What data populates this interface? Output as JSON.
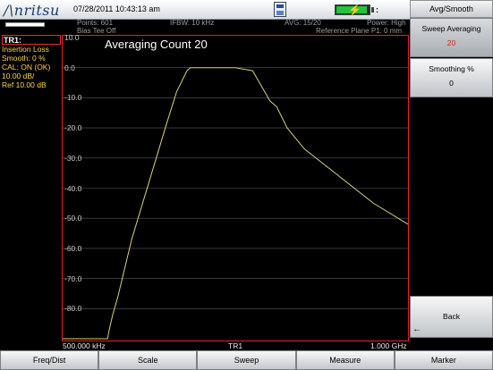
{
  "header": {
    "brand": "/\\nritsu",
    "datetime": "07/28/2011 10:43:13 am",
    "points": "Points: 601",
    "bias_tee": "Bias Tee Off",
    "ifbw": "IFBW: 10 kHz",
    "avg": "AVG: 15/20",
    "power": "Power: High",
    "ref_plane": "Reference Plane P1: 0 mm",
    "battery_level": 0.95,
    "signal": ":"
  },
  "left_panel": {
    "trace": "TR1:",
    "lines": [
      "Insertion Loss",
      "Smooth: 0 %",
      "CAL: ON (OK)",
      "10.00 dB/",
      "Ref 10.00 dB"
    ]
  },
  "graph": {
    "title": "Averaging Count  20",
    "y_ticks": [
      "10.0",
      "0.0",
      "-10.0",
      "-20.0",
      "-30.0",
      "-40.0",
      "-50.0",
      "-60.0",
      "-70.0",
      "-80.0"
    ],
    "x_start": "500.000 kHz",
    "x_center": "TR1",
    "x_stop": "1.000 GHz",
    "ref_arrow": "◀",
    "trace_color": "#d8d27a",
    "grid_color": "#5a5a5a"
  },
  "chart_data": {
    "type": "line",
    "title": "Averaging Count  20",
    "xlabel": "",
    "ylabel": "",
    "x_range": [
      "500.000 kHz",
      "1.000 GHz"
    ],
    "ylim": [
      -90,
      10
    ],
    "y_ticks": [
      10,
      0,
      -10,
      -20,
      -30,
      -40,
      -50,
      -60,
      -70,
      -80
    ],
    "series": [
      {
        "x_fraction": [
          0.0,
          0.13,
          0.135,
          0.145,
          0.16,
          0.2,
          0.25,
          0.3,
          0.33,
          0.36,
          0.37,
          0.4,
          0.5,
          0.55,
          0.57,
          0.6,
          0.62,
          0.65,
          0.7,
          0.8,
          0.9,
          1.0
        ],
        "values": [
          -90,
          -90,
          -87,
          -82,
          -76,
          -57,
          -38,
          -19,
          -8,
          -1,
          0,
          0,
          0,
          -1,
          -5,
          -11,
          -13,
          -20,
          -27,
          -36,
          -45,
          -52
        ]
      }
    ]
  },
  "softkeys": {
    "menu_title": "Avg/Smooth",
    "sweep_averaging_label": "Sweep Averaging",
    "sweep_averaging_value": "20",
    "smoothing_label": "Smoothing %",
    "smoothing_value": "0",
    "back_label": "Back",
    "back_arrow": "←"
  },
  "bottom_menu": [
    "Freq/Dist",
    "Scale",
    "Sweep",
    "Measure",
    "Marker"
  ]
}
